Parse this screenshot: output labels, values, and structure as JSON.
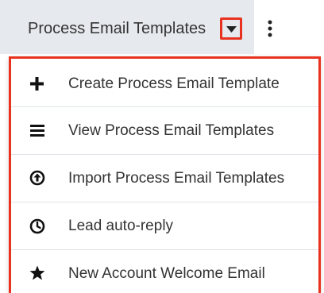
{
  "header": {
    "module_title": "Process Email Templates",
    "caret_icon": "caret-down-icon",
    "more_icon": "kebab-icon",
    "accent_color": "#e8321f"
  },
  "menu": {
    "items": [
      {
        "label": "Create Process Email Template",
        "icon": "plus-icon"
      },
      {
        "label": "View Process Email Templates",
        "icon": "list-icon"
      },
      {
        "label": "Import Process Email Templates",
        "icon": "upload-circle-icon"
      },
      {
        "label": "Lead auto-reply",
        "icon": "clock-icon"
      },
      {
        "label": "New Account Welcome Email",
        "icon": "star-icon"
      }
    ]
  }
}
